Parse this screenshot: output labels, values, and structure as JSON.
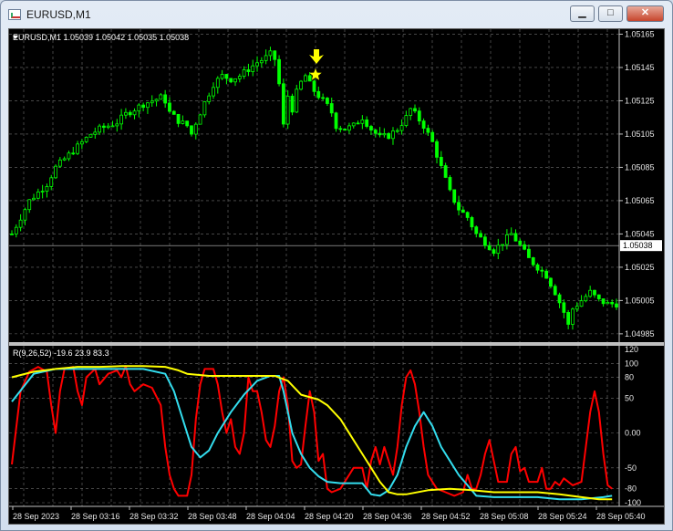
{
  "window": {
    "title": "EURUSD,M1",
    "min_symbol": "▁",
    "max_symbol": "□",
    "close_symbol": "✕"
  },
  "chart_data": [
    {
      "type": "candlestick",
      "header": "EURUSD,M1  1.05039 1.05042 1.05035 1.05038",
      "symbol": "EURUSD",
      "timeframe": "M1",
      "ohlc": {
        "open": 1.05039,
        "high": 1.05042,
        "low": 1.05035,
        "close": 1.05038
      },
      "y_ticks": [
        "1.05165",
        "1.05145",
        "1.05125",
        "1.05105",
        "1.05085",
        "1.05065",
        "1.05045",
        "1.05025",
        "1.05005",
        "1.04985"
      ],
      "ylim": [
        1.0498,
        1.05168
      ],
      "current_price": "1.05038",
      "annotations": [
        "yellow-arrow-down",
        "yellow-star"
      ],
      "colors": {
        "background": "#000000",
        "candles": "#00ff00",
        "grid": "#707070",
        "price_line": "#c0c0c0",
        "marker": "#ffff00"
      },
      "grid": true,
      "close_path": [
        [
          0,
          1.05045
        ],
        [
          2,
          1.05055
        ],
        [
          4,
          1.05065
        ],
        [
          6,
          1.0507
        ],
        [
          8,
          1.05075
        ],
        [
          10,
          1.05085
        ],
        [
          12,
          1.0509
        ],
        [
          14,
          1.05095
        ],
        [
          16,
          1.051
        ],
        [
          18,
          1.05105
        ],
        [
          20,
          1.05108
        ],
        [
          22,
          1.0511
        ],
        [
          24,
          1.05112
        ],
        [
          26,
          1.05117
        ],
        [
          28,
          1.0512
        ],
        [
          30,
          1.05123
        ],
        [
          32,
          1.05125
        ],
        [
          34,
          1.05127
        ],
        [
          35,
          1.05125
        ],
        [
          36,
          1.05118
        ],
        [
          38,
          1.05113
        ],
        [
          40,
          1.0511
        ],
        [
          41,
          1.05105
        ],
        [
          42,
          1.05112
        ],
        [
          43,
          1.05118
        ],
        [
          44,
          1.05124
        ],
        [
          46,
          1.05135
        ],
        [
          48,
          1.0514
        ],
        [
          50,
          1.05138
        ],
        [
          52,
          1.0514
        ],
        [
          54,
          1.05144
        ],
        [
          56,
          1.05148
        ],
        [
          58,
          1.05151
        ],
        [
          59,
          1.05153
        ],
        [
          60,
          1.0515
        ],
        [
          61,
          1.05135
        ],
        [
          62,
          1.0511
        ],
        [
          63,
          1.05128
        ],
        [
          64,
          1.0512
        ],
        [
          65,
          1.0513
        ],
        [
          66,
          1.05136
        ],
        [
          67,
          1.0514
        ],
        [
          68,
          1.05135
        ],
        [
          69,
          1.05131
        ],
        [
          70,
          1.05128
        ],
        [
          71,
          1.05125
        ],
        [
          72,
          1.05122
        ],
        [
          73,
          1.05118
        ],
        [
          74,
          1.0511
        ],
        [
          76,
          1.05108
        ],
        [
          78,
          1.0511
        ],
        [
          80,
          1.05115
        ],
        [
          82,
          1.05108
        ],
        [
          84,
          1.05103
        ],
        [
          86,
          1.05104
        ],
        [
          88,
          1.05108
        ],
        [
          90,
          1.05115
        ],
        [
          91,
          1.0512
        ],
        [
          92,
          1.05117
        ],
        [
          94,
          1.0511
        ],
        [
          96,
          1.051
        ],
        [
          98,
          1.05085
        ],
        [
          100,
          1.0507
        ],
        [
          102,
          1.0506
        ],
        [
          104,
          1.05055
        ],
        [
          106,
          1.05045
        ],
        [
          108,
          1.0504
        ],
        [
          110,
          1.05035
        ],
        [
          112,
          1.0504
        ],
        [
          114,
          1.05045
        ],
        [
          116,
          1.05038
        ],
        [
          118,
          1.0503
        ],
        [
          120,
          1.05025
        ],
        [
          122,
          1.0502
        ],
        [
          124,
          1.0501
        ],
        [
          126,
          1.04998
        ],
        [
          127,
          1.0499
        ],
        [
          128,
          1.05
        ],
        [
          130,
          1.05005
        ],
        [
          132,
          1.0501
        ],
        [
          134,
          1.05005
        ],
        [
          136,
          1.05003
        ],
        [
          138,
          1.05003
        ]
      ]
    },
    {
      "type": "line",
      "header": "R(9,26,52) -19.6 23.9 83.3",
      "y_ticks": [
        "120",
        "100",
        "80",
        "50",
        "0.00",
        "-50",
        "-80",
        "-100"
      ],
      "ylim": [
        -100,
        120
      ],
      "x_tick_labels": [
        "28 Sep 2023",
        "28 Sep 03:16",
        "28 Sep 03:32",
        "28 Sep 03:48",
        "28 Sep 04:04",
        "28 Sep 04:20",
        "28 Sep 04:36",
        "28 Sep 04:52",
        "28 Sep 05:08",
        "28 Sep 05:24",
        "28 Sep 05:40"
      ],
      "series": [
        {
          "color": "#ff0000",
          "values": [
            [
              0,
              -45
            ],
            [
              2,
              60
            ],
            [
              4,
              88
            ],
            [
              6,
              95
            ],
            [
              8,
              88
            ],
            [
              9,
              40
            ],
            [
              10,
              0
            ],
            [
              11,
              60
            ],
            [
              12,
              92
            ],
            [
              14,
              95
            ],
            [
              15,
              60
            ],
            [
              16,
              40
            ],
            [
              17,
              80
            ],
            [
              19,
              92
            ],
            [
              20,
              70
            ],
            [
              22,
              85
            ],
            [
              24,
              90
            ],
            [
              25,
              80
            ],
            [
              26,
              96
            ],
            [
              27,
              70
            ],
            [
              28,
              60
            ],
            [
              30,
              70
            ],
            [
              32,
              65
            ],
            [
              34,
              40
            ],
            [
              35,
              -20
            ],
            [
              36,
              -60
            ],
            [
              37,
              -80
            ],
            [
              38,
              -90
            ],
            [
              40,
              -90
            ],
            [
              41,
              -60
            ],
            [
              42,
              20
            ],
            [
              43,
              70
            ],
            [
              44,
              92
            ],
            [
              46,
              92
            ],
            [
              47,
              70
            ],
            [
              48,
              30
            ],
            [
              49,
              0
            ],
            [
              50,
              20
            ],
            [
              51,
              -20
            ],
            [
              52,
              -30
            ],
            [
              53,
              0
            ],
            [
              54,
              80
            ],
            [
              55,
              60
            ],
            [
              56,
              60
            ],
            [
              57,
              30
            ],
            [
              58,
              -10
            ],
            [
              59,
              -20
            ],
            [
              60,
              10
            ],
            [
              61,
              60
            ],
            [
              62,
              80
            ],
            [
              63,
              40
            ],
            [
              64,
              -40
            ],
            [
              65,
              -50
            ],
            [
              66,
              -45
            ],
            [
              67,
              10
            ],
            [
              68,
              60
            ],
            [
              69,
              30
            ],
            [
              70,
              -40
            ],
            [
              71,
              -30
            ],
            [
              72,
              -80
            ],
            [
              73,
              -85
            ],
            [
              75,
              -80
            ],
            [
              77,
              -60
            ],
            [
              78,
              -50
            ],
            [
              80,
              -50
            ],
            [
              81,
              -80
            ],
            [
              82,
              -40
            ],
            [
              83,
              -20
            ],
            [
              84,
              -45
            ],
            [
              85,
              -20
            ],
            [
              86,
              -40
            ],
            [
              87,
              -60
            ],
            [
              88,
              -20
            ],
            [
              89,
              40
            ],
            [
              90,
              80
            ],
            [
              91,
              90
            ],
            [
              92,
              70
            ],
            [
              93,
              30
            ],
            [
              94,
              -20
            ],
            [
              95,
              -60
            ],
            [
              96,
              -70
            ],
            [
              97,
              -80
            ],
            [
              99,
              -85
            ],
            [
              101,
              -90
            ],
            [
              103,
              -85
            ],
            [
              104,
              -60
            ],
            [
              105,
              -80
            ],
            [
              106,
              -80
            ],
            [
              107,
              -60
            ],
            [
              108,
              -30
            ],
            [
              109,
              -10
            ],
            [
              110,
              -40
            ],
            [
              111,
              -70
            ],
            [
              113,
              -70
            ],
            [
              114,
              -30
            ],
            [
              115,
              -20
            ],
            [
              116,
              -55
            ],
            [
              117,
              -50
            ],
            [
              118,
              -70
            ],
            [
              120,
              -70
            ],
            [
              121,
              -50
            ],
            [
              122,
              -80
            ],
            [
              123,
              -80
            ],
            [
              124,
              -70
            ],
            [
              125,
              -75
            ],
            [
              126,
              -65
            ],
            [
              128,
              -75
            ],
            [
              130,
              -70
            ],
            [
              131,
              -20
            ],
            [
              132,
              30
            ],
            [
              133,
              60
            ],
            [
              134,
              30
            ],
            [
              135,
              -30
            ],
            [
              136,
              -75
            ],
            [
              137,
              -80
            ]
          ]
        },
        {
          "color": "#33ddee",
          "values": [
            [
              0,
              45
            ],
            [
              5,
              85
            ],
            [
              10,
              92
            ],
            [
              20,
              92
            ],
            [
              30,
              92
            ],
            [
              35,
              85
            ],
            [
              37,
              60
            ],
            [
              39,
              20
            ],
            [
              41,
              -20
            ],
            [
              43,
              -35
            ],
            [
              45,
              -25
            ],
            [
              47,
              0
            ],
            [
              50,
              30
            ],
            [
              53,
              55
            ],
            [
              56,
              75
            ],
            [
              59,
              82
            ],
            [
              61,
              82
            ],
            [
              62,
              60
            ],
            [
              63,
              30
            ],
            [
              64,
              0
            ],
            [
              66,
              -30
            ],
            [
              68,
              -50
            ],
            [
              70,
              -62
            ],
            [
              72,
              -70
            ],
            [
              75,
              -72
            ],
            [
              80,
              -72
            ],
            [
              81,
              -80
            ],
            [
              82,
              -88
            ],
            [
              84,
              -90
            ],
            [
              86,
              -82
            ],
            [
              88,
              -60
            ],
            [
              90,
              -20
            ],
            [
              92,
              10
            ],
            [
              94,
              30
            ],
            [
              96,
              10
            ],
            [
              98,
              -20
            ],
            [
              100,
              -40
            ],
            [
              102,
              -60
            ],
            [
              104,
              -75
            ],
            [
              106,
              -90
            ],
            [
              110,
              -92
            ],
            [
              115,
              -92
            ],
            [
              120,
              -92
            ],
            [
              125,
              -95
            ],
            [
              130,
              -95
            ],
            [
              135,
              -92
            ],
            [
              137,
              -90
            ]
          ]
        },
        {
          "color": "#ffff00",
          "values": [
            [
              0,
              80
            ],
            [
              5,
              88
            ],
            [
              10,
              92
            ],
            [
              15,
              95
            ],
            [
              20,
              95
            ],
            [
              25,
              96
            ],
            [
              30,
              96
            ],
            [
              35,
              95
            ],
            [
              38,
              90
            ],
            [
              40,
              85
            ],
            [
              45,
              82
            ],
            [
              50,
              82
            ],
            [
              55,
              82
            ],
            [
              60,
              82
            ],
            [
              63,
              75
            ],
            [
              66,
              55
            ],
            [
              70,
              48
            ],
            [
              72,
              40
            ],
            [
              75,
              20
            ],
            [
              78,
              -10
            ],
            [
              80,
              -30
            ],
            [
              82,
              -50
            ],
            [
              84,
              -70
            ],
            [
              86,
              -85
            ],
            [
              88,
              -88
            ],
            [
              90,
              -88
            ],
            [
              95,
              -82
            ],
            [
              100,
              -80
            ],
            [
              105,
              -82
            ],
            [
              110,
              -85
            ],
            [
              115,
              -85
            ],
            [
              120,
              -85
            ],
            [
              125,
              -88
            ],
            [
              130,
              -92
            ],
            [
              134,
              -95
            ],
            [
              137,
              -95
            ]
          ]
        }
      ],
      "colors": {
        "background": "#000000",
        "grid": "#707070"
      },
      "grid": true
    }
  ]
}
